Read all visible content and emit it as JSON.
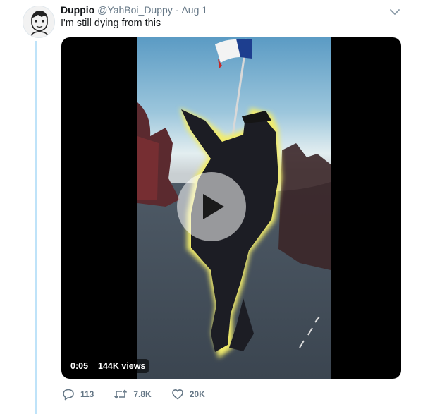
{
  "tweet": {
    "name": "Duppio",
    "handle": "@YahBoi_Duppy",
    "separator": "·",
    "date": "Aug 1",
    "text": "I'm still dying from this"
  },
  "video": {
    "duration": "0:05",
    "views": "144K views"
  },
  "actions": {
    "replies": "113",
    "retweets": "7.8K",
    "likes": "20K"
  },
  "icons": {
    "more": "chevron-down-icon",
    "reply": "speech-bubble-icon",
    "retweet": "retweet-arrows-icon",
    "like": "heart-icon",
    "play": "play-icon"
  },
  "colors": {
    "thread_line": "#bfe3f9",
    "secondary_text": "#657786",
    "glow": "#e6e15a"
  }
}
